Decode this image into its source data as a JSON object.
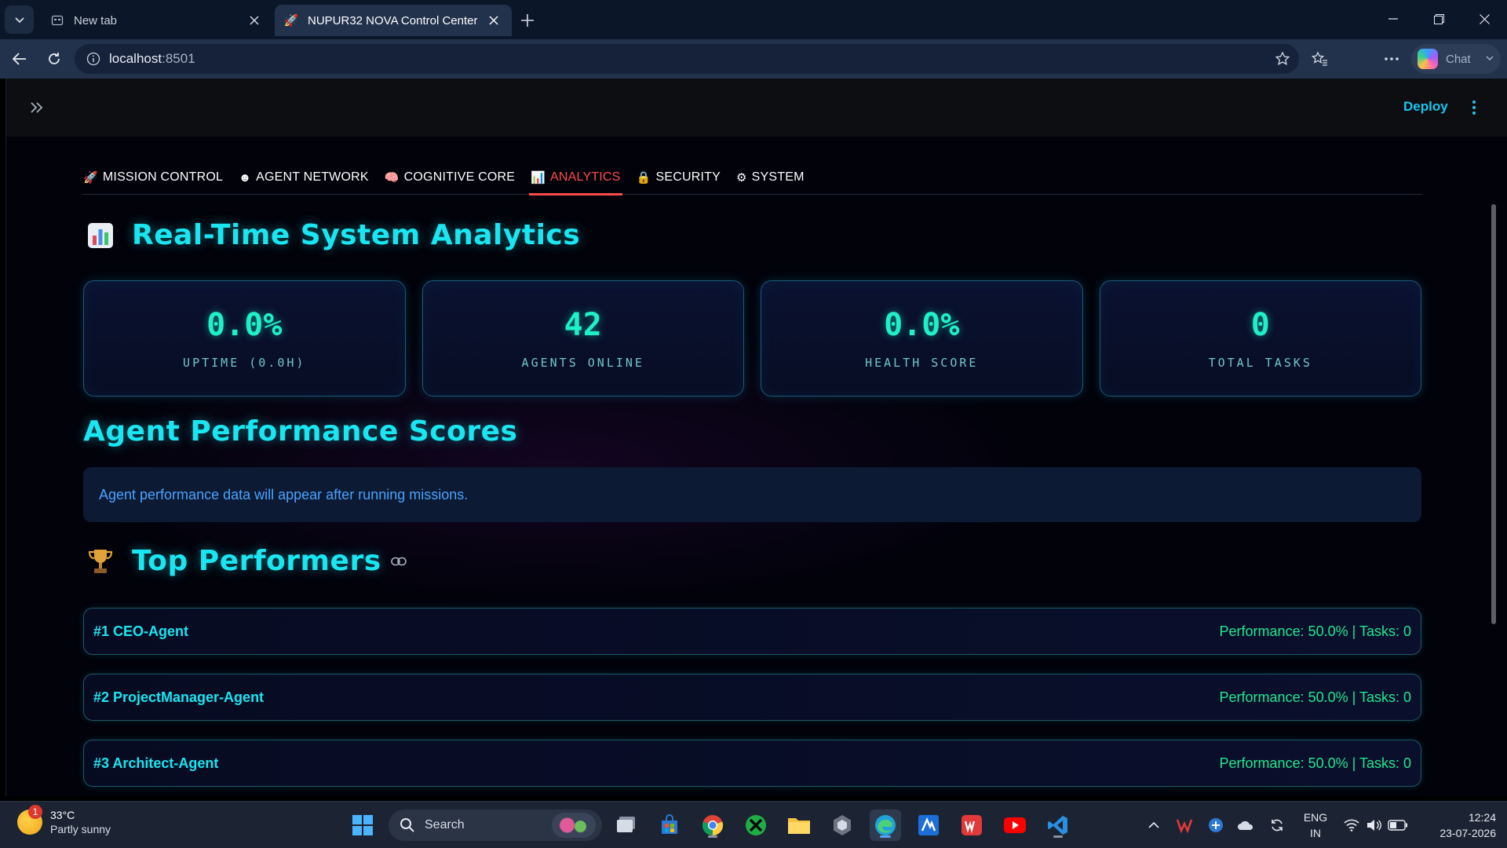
{
  "browser": {
    "tabs": [
      {
        "title": "New tab",
        "active": false
      },
      {
        "title": "NUPUR32 NOVA Control Center",
        "active": true
      }
    ],
    "url_host": "localhost",
    "url_port": ":8501",
    "chat_label": "Chat"
  },
  "app": {
    "deploy_label": "Deploy",
    "nav_tabs": [
      {
        "icon": "🚀",
        "label": "MISSION CONTROL"
      },
      {
        "icon": "☻",
        "label": "AGENT NETWORK"
      },
      {
        "icon": "🧠",
        "label": "COGNITIVE CORE"
      },
      {
        "icon": "📊",
        "label": "ANALYTICS"
      },
      {
        "icon": "🔒",
        "label": "SECURITY"
      },
      {
        "icon": "⚙",
        "label": "SYSTEM"
      }
    ],
    "active_tab": "ANALYTICS",
    "analytics_title": "Real-Time System Analytics",
    "metrics": [
      {
        "value": "0.0%",
        "label": "UPTIME (0.0H)"
      },
      {
        "value": "42",
        "label": "AGENTS ONLINE"
      },
      {
        "value": "0.0%",
        "label": "HEALTH SCORE"
      },
      {
        "value": "0",
        "label": "TOTAL TASKS"
      }
    ],
    "performance_title": "Agent Performance Scores",
    "performance_info": "Agent performance data will appear after running missions.",
    "top_performers_title": "Top Performers",
    "top_performers": [
      {
        "name": "#1 CEO-Agent",
        "stats": "Performance: 50.0% | Tasks: 0"
      },
      {
        "name": "#2 ProjectManager-Agent",
        "stats": "Performance: 50.0% | Tasks: 0"
      },
      {
        "name": "#3 Architect-Agent",
        "stats": "Performance: 50.0% | Tasks: 0"
      }
    ]
  },
  "taskbar": {
    "weather_temp": "33°C",
    "weather_desc": "Partly sunny",
    "weather_badge": "1",
    "search_label": "Search",
    "lang_line1": "ENG",
    "lang_line2": "IN",
    "time": "12:24",
    "date": "23-07-2026"
  }
}
